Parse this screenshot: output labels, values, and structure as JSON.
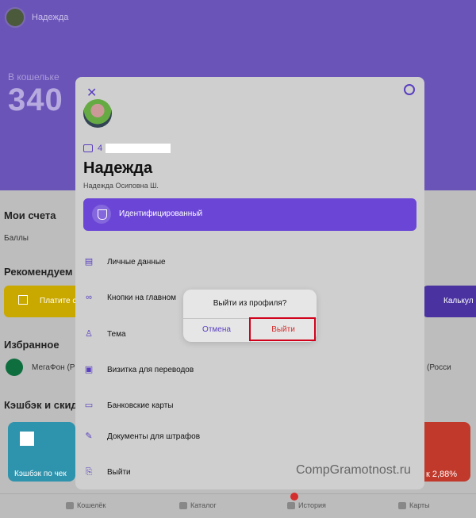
{
  "background": {
    "user_name": "Надежда",
    "wallet_label": "В кошельке",
    "wallet_amount": "340",
    "sections": {
      "accounts": "Мои счета",
      "points": "Баллы",
      "recommend": "Рекомендуем",
      "favorites": "Избранное",
      "cashback": "Кэшбэк и скид"
    },
    "promo_yellow": "Платите с",
    "promo_right": "Калькул",
    "fav_left": "МегаФон (Р",
    "fav_right": "(Росси",
    "cashback_left": "Кэшбэк по чек",
    "cashback_right": "к 2,88%",
    "tabs": [
      "Кошелёк",
      "Каталог",
      "История",
      "Карты"
    ]
  },
  "profile": {
    "phone_prefix": "4",
    "name": "Надежда",
    "full_name": "Надежда Осиповна Ш.",
    "status": "Идентифицированный",
    "menu": [
      "Личные данные",
      "Кнопки на главном",
      "Тема",
      "Визитка для переводов",
      "Банковские карты",
      "Документы для штрафов",
      "Выйти"
    ]
  },
  "dialog": {
    "title": "Выйти из профиля?",
    "cancel": "Отмена",
    "confirm": "Выйти"
  },
  "watermark": "CompGramotnost.ru",
  "colors": {
    "accent": "#5a3fc0",
    "status_button": "#6b46d6",
    "danger": "#d32f2f"
  }
}
